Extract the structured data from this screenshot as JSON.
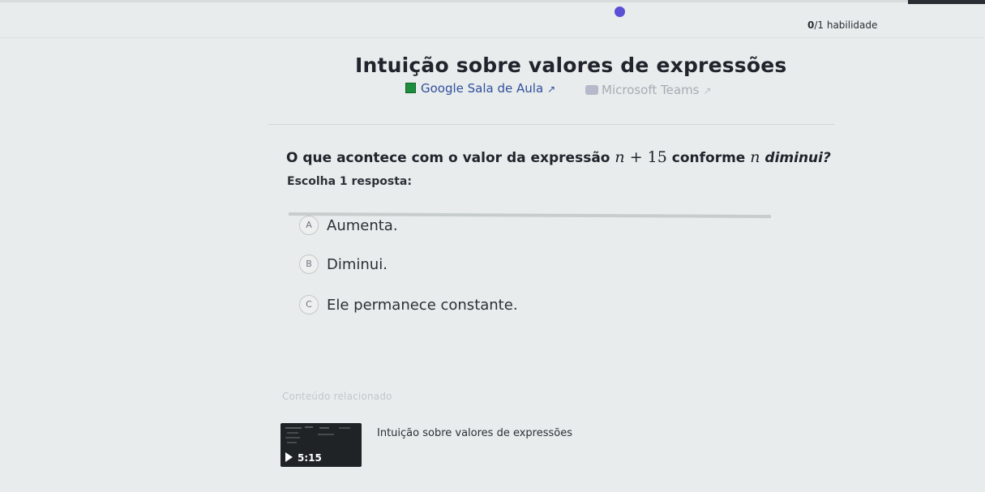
{
  "progress": {
    "skill_count": "0",
    "skill_total_label": "/1 habilidade",
    "accent_color": "#5b4fd6"
  },
  "exercise": {
    "title": "Intuição sobre valores de expressões"
  },
  "share": {
    "google_label": "Google Sala de Aula",
    "google_icon": "google-classroom-icon",
    "teams_label": "Microsoft Teams",
    "teams_icon": "microsoft-teams-icon",
    "external_icon": "external-link-icon",
    "external_glyph": "↗"
  },
  "question": {
    "prefix": "O que acontece com o valor da expressão",
    "math_var": "n",
    "math_rest": " + 15",
    "middle": "conforme",
    "math_var2": "n",
    "suffix": "diminui?",
    "instruction": "Escolha 1 resposta:"
  },
  "choices": [
    {
      "letter": "A",
      "label": "Aumenta."
    },
    {
      "letter": "B",
      "label": "Diminui."
    },
    {
      "letter": "C",
      "label": "Ele permanece constante."
    }
  ],
  "related": {
    "heading": "Conteúdo relacionado",
    "video": {
      "title": "Intuição sobre valores de expressões",
      "duration": "5:15",
      "play_icon": "play-icon"
    }
  }
}
